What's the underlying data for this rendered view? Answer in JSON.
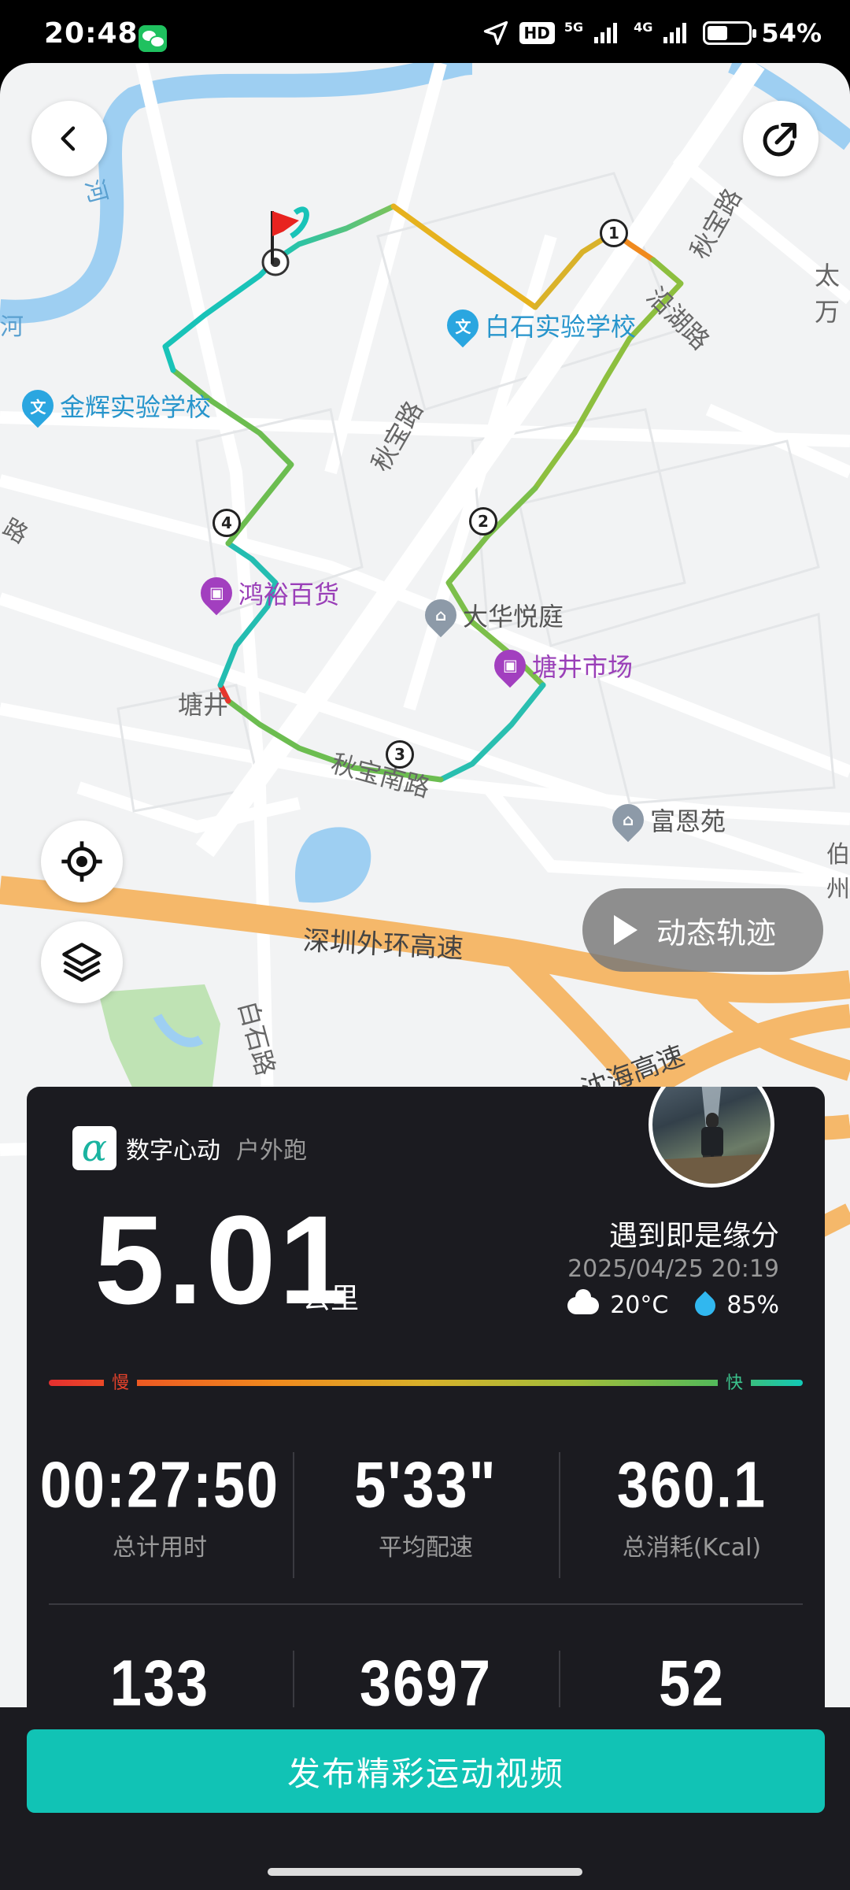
{
  "status_bar": {
    "time": "20:48",
    "hd_badge": "HD",
    "net_5g": "5G",
    "net_4g": "4G",
    "battery_percent": 54,
    "battery_text": "54%"
  },
  "map": {
    "road_labels": [
      "秋宝路",
      "秋宝路",
      "沿湖路",
      "秋宝南路",
      "深圳外环高速",
      "白石路",
      "沈海高速",
      "河",
      "河",
      "路"
    ],
    "place_labels": [
      "塘井",
      "太万",
      "伯州"
    ],
    "pois": [
      {
        "name": "白石实验学校",
        "icon": "school-icon",
        "color": "#2aa6e0"
      },
      {
        "name": "金辉实验学校",
        "icon": "school-icon",
        "color": "#2aa6e0"
      },
      {
        "name": "鸿裕百货",
        "icon": "shop-icon",
        "color": "#a23fbf"
      },
      {
        "name": "大华悦庭",
        "icon": "residence-icon",
        "color": "#8d9aa8"
      },
      {
        "name": "塘井市场",
        "icon": "shop-icon",
        "color": "#a23fbf"
      },
      {
        "name": "富恩苑",
        "icon": "residence-icon",
        "color": "#8d9aa8"
      }
    ],
    "km_markers": [
      "1",
      "2",
      "3",
      "4"
    ],
    "replay_label": "动态轨迹"
  },
  "card": {
    "brand_name": "数字心动",
    "activity_type": "户外跑",
    "distance": "5.01",
    "distance_unit": "公里",
    "slogan": "遇到即是缘分",
    "datetime": "2025/04/25   20:19",
    "temperature": "20°C",
    "humidity": "85%",
    "pace_slow": "慢",
    "pace_fast": "快",
    "stats_row1": [
      {
        "value": "00:27:50",
        "label": "总计用时"
      },
      {
        "value": "5'33\"",
        "label": "平均配速"
      },
      {
        "value": "360.1",
        "label": "总消耗(Kcal)"
      }
    ],
    "stats_row2": [
      {
        "value": "133"
      },
      {
        "value": "3697"
      },
      {
        "value": "52"
      }
    ]
  },
  "publish_button": "发布精彩运动视频",
  "colors": {
    "accent": "#11c3b5",
    "card_bg": "#1b1b20",
    "route_fast": "#12c9b6",
    "route_mid": "#7cbf4a",
    "route_slow": "#e8b41f"
  }
}
